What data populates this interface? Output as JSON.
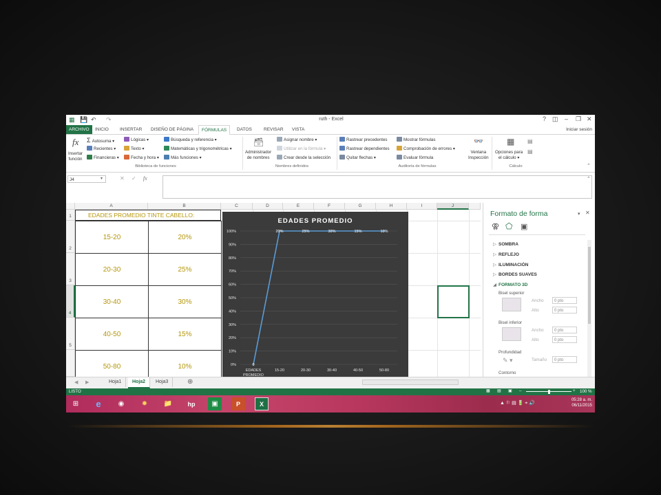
{
  "window": {
    "title": "ruth - Excel",
    "signin": "Iniciar sesión"
  },
  "tabs": [
    "ARCHIVO",
    "INICIO",
    "INSERTAR",
    "DISEÑO DE PÁGINA",
    "FÓRMULAS",
    "DATOS",
    "REVISAR",
    "VISTA"
  ],
  "ribbon": {
    "insert_function": [
      "Insertar",
      "función"
    ],
    "library": {
      "autosum": "Autosuma",
      "recent": "Recientes",
      "financial": "Financieras",
      "logical": "Lógicas",
      "text": "Texto",
      "datetime": "Fecha y hora",
      "lookup": "Búsqueda y referencia",
      "math": "Matemáticas y trigonométricas",
      "more": "Más funciones",
      "group": "Biblioteca de funciones"
    },
    "names": {
      "manager": [
        "Administrador",
        "de nombres"
      ],
      "define": "Asignar nombre",
      "use": "Utilizar en la fórmula",
      "create": "Crear desde la selección",
      "group": "Nombres definidos"
    },
    "audit": {
      "precedents": "Rastrear precedentes",
      "dependents": "Rastrear dependientes",
      "remove": "Quitar flechas",
      "show": "Mostrar fórmulas",
      "check": "Comprobación de errores",
      "evaluate": "Evaluar fórmula",
      "watch": [
        "Ventana",
        "Inspección"
      ],
      "group": "Auditoría de fórmulas"
    },
    "calc": {
      "options": [
        "Opciones para",
        "el cálculo"
      ],
      "group": "Cálculo"
    }
  },
  "formula_bar": {
    "name_box": "J4",
    "fx": "fx",
    "value": ""
  },
  "columns": [
    "A",
    "B",
    "C",
    "D",
    "E",
    "F",
    "G",
    "H",
    "I",
    "J"
  ],
  "rows": [
    "1",
    "2",
    "3",
    "4",
    "5"
  ],
  "table": {
    "header": "EDADES PROMEDIO TINTE CABELLO:",
    "rows": [
      [
        "15-20",
        "20%"
      ],
      [
        "20-30",
        "25%"
      ],
      [
        "30-40",
        "30%"
      ],
      [
        "40-50",
        "15%"
      ],
      [
        "50-80",
        "10%"
      ]
    ]
  },
  "chart_data": {
    "type": "line",
    "title": "EDADES PROMEDIO",
    "categories": [
      "EDADES",
      "15-20",
      "20-30",
      "30-40",
      "40-50",
      "50-80"
    ],
    "values": [
      0,
      100,
      100,
      100,
      100,
      100
    ],
    "data_labels": [
      "0",
      "20%",
      "25%",
      "30%",
      "15%",
      "10%"
    ],
    "y_ticks": [
      "0%",
      "10%",
      "20%",
      "30%",
      "40%",
      "50%",
      "60%",
      "70%",
      "80%",
      "90%",
      "100%"
    ],
    "ylim": [
      0,
      100
    ],
    "first_category_suffix": "PROMEDIO",
    "colors": {
      "background": "#3b3b3b",
      "line": "#5b9bd5",
      "grid": "#565656"
    }
  },
  "pane": {
    "title": "Formato de forma",
    "sections": [
      "SOMBRA",
      "REFLEJO",
      "ILUMINACIÓN",
      "BORDES SUAVES",
      "FORMATO 3D"
    ],
    "bisel_sup": "Bisel superior",
    "bisel_inf": "Bisel inferior",
    "profundidad": "Profundidad",
    "contorno": "Contorno",
    "ancho": "Ancho",
    "alto": "Alto",
    "tamano": "Tamaño",
    "zero": "0 pto"
  },
  "sheets": [
    "Hoja1",
    "Hoja2",
    "Hoja3"
  ],
  "status": {
    "ready": "LISTO",
    "zoom": "100 %"
  },
  "clock": {
    "time": "05:28 a. m.",
    "date": "06/11/2015"
  },
  "colors": {
    "excel_green": "#217346",
    "table_text": "#b5960a"
  }
}
